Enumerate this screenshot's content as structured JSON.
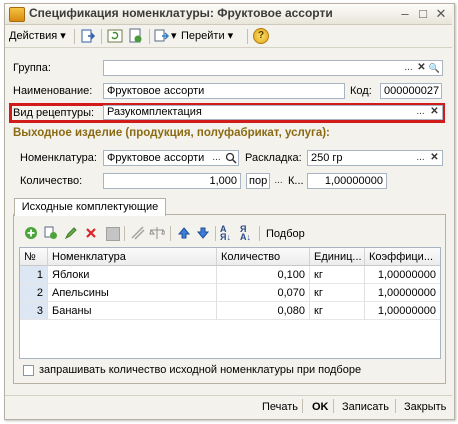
{
  "window": {
    "title": "Спецификация номенклатуры: Фруктовое ассорти"
  },
  "toolbar": {
    "actions": "Действия",
    "goto": "Перейти",
    "help": "?"
  },
  "form": {
    "group_label": "Группа:",
    "group_value": "",
    "name_label": "Наименование:",
    "name_value": "Фруктовое ассорти",
    "code_label": "Код:",
    "code_value": "000000027",
    "recipe_type_label": "Вид рецептуры:",
    "recipe_type_value": "Разукомплектация",
    "output_section": "Выходное изделие (продукция, полуфабрикат, услуга):",
    "nom_label": "Номенклатура:",
    "nom_value": "Фруктовое ассорти",
    "layout_label": "Раскладка:",
    "layout_value": "250 гр",
    "qty_label": "Количество:",
    "qty_value": "1,000",
    "unit_value": "пор",
    "coef_label": "К...",
    "coef_value": "1,00000000"
  },
  "tab": {
    "label": "Исходные комплектующие"
  },
  "tab_toolbar": {
    "pick": "Подбор"
  },
  "table": {
    "columns": [
      "№",
      "Номенклатура",
      "Количество",
      "Единиц...",
      "Коэффици..."
    ],
    "rows": [
      {
        "n": "1",
        "name": "Яблоки",
        "qty": "0,100",
        "unit": "кг",
        "coef": "1,00000000"
      },
      {
        "n": "2",
        "name": "Апельсины",
        "qty": "0,070",
        "unit": "кг",
        "coef": "1,00000000"
      },
      {
        "n": "3",
        "name": "Бананы",
        "qty": "0,080",
        "unit": "кг",
        "coef": "1,00000000"
      }
    ]
  },
  "checkbox": {
    "label": "запрашивать количество исходной номенклатуры при подборе",
    "checked": false
  },
  "buttons": {
    "print": "Печать",
    "ok": "OK",
    "save": "Записать",
    "close": "Закрыть"
  },
  "colors": {
    "highlight_frame": "#d11a1a",
    "section_title": "#8a6a14",
    "row_number_bg": "#dde7f3"
  }
}
